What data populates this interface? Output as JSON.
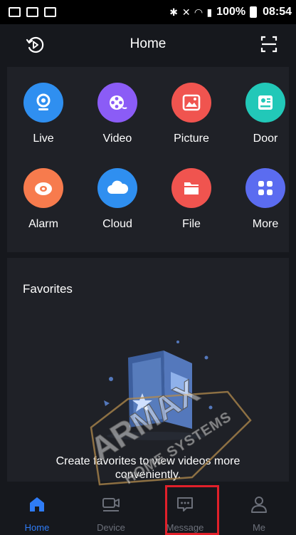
{
  "status_bar": {
    "battery": "100%",
    "time": "08:54"
  },
  "header": {
    "title": "Home",
    "left_icon": "playback-history-icon",
    "right_icon": "scan-icon"
  },
  "grid": [
    {
      "label": "Live",
      "icon": "live-camera-icon",
      "color": "#2f8ff0"
    },
    {
      "label": "Video",
      "icon": "video-reel-icon",
      "color": "#8b5cf6"
    },
    {
      "label": "Picture",
      "icon": "picture-icon",
      "color": "#f0544f"
    },
    {
      "label": "Door",
      "icon": "door-intercom-icon",
      "color": "#22c8b8"
    },
    {
      "label": "Alarm",
      "icon": "alarm-icon",
      "color": "#f77b4d"
    },
    {
      "label": "Cloud",
      "icon": "cloud-icon",
      "color": "#2f8ff0"
    },
    {
      "label": "File",
      "icon": "file-folder-icon",
      "color": "#f0544f"
    },
    {
      "label": "More",
      "icon": "more-grid-icon",
      "color": "#5b6cf0"
    }
  ],
  "favorites": {
    "title": "Favorites",
    "empty_line1": "Create favorites to view videos more",
    "empty_line2": "conveniently."
  },
  "watermark": {
    "brand": "ARMAX",
    "tagline": "HOME SYSTEMS"
  },
  "bottom_nav": [
    {
      "label": "Home",
      "icon": "home-icon",
      "active": true
    },
    {
      "label": "Device",
      "icon": "device-icon",
      "active": false
    },
    {
      "label": "Message",
      "icon": "message-icon",
      "active": false
    },
    {
      "label": "Me",
      "icon": "profile-icon",
      "active": false
    }
  ],
  "colors": {
    "accent": "#2f7cf6",
    "background": "#16181d",
    "card": "#1f2127",
    "highlight": "#e0202a"
  }
}
